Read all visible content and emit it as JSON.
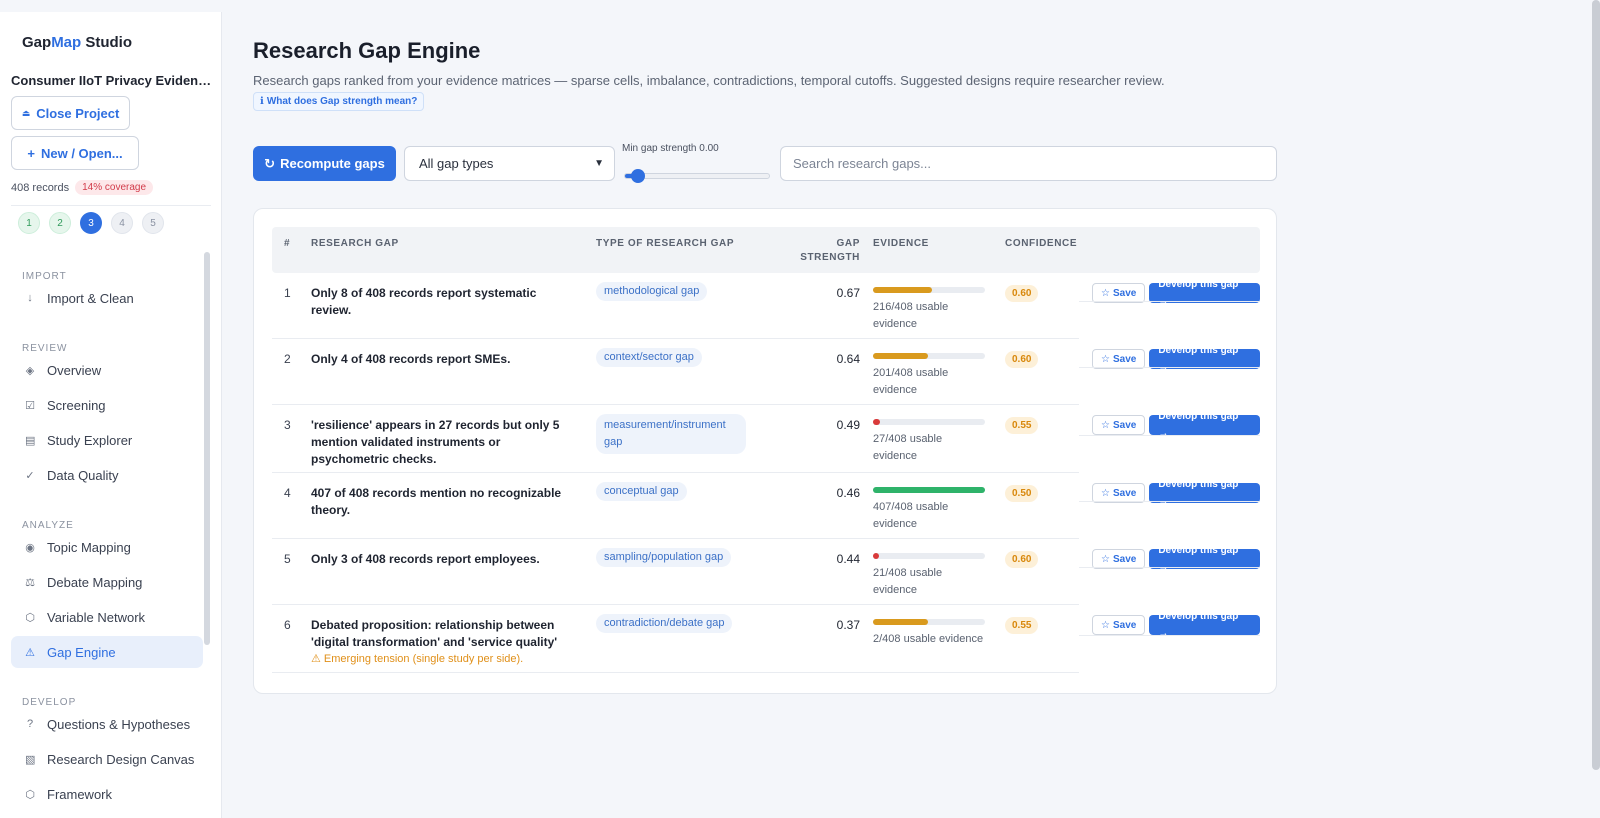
{
  "brand": {
    "part1": "Gap",
    "part2": "Map",
    "part3": " Studio"
  },
  "project": {
    "name": "Consumer IIoT Privacy Evidence ...",
    "close_label": "Close Project",
    "new_label": "New / Open...",
    "records": "408 records",
    "coverage": "14% coverage"
  },
  "steps": [
    "1",
    "2",
    "3",
    "4",
    "5"
  ],
  "nav": {
    "import_header": "IMPORT",
    "import_clean": "Import & Clean",
    "review_header": "REVIEW",
    "overview": "Overview",
    "screening": "Screening",
    "study_explorer": "Study Explorer",
    "data_quality": "Data Quality",
    "analyze_header": "ANALYZE",
    "topic_mapping": "Topic Mapping",
    "debate_mapping": "Debate Mapping",
    "variable_network": "Variable Network",
    "gap_engine": "Gap Engine",
    "develop_header": "DEVELOP",
    "questions": "Questions & Hypotheses",
    "design_canvas": "Research Design Canvas",
    "framework": "Framework"
  },
  "page": {
    "title": "Research Gap Engine",
    "subtitle": "Research gaps ranked from your evidence matrices — sparse cells, imbalance, contradictions, temporal cutoffs. Suggested designs require researcher review.",
    "help": "What does Gap strength mean?"
  },
  "controls": {
    "recompute": "Recompute gaps",
    "gap_type_selected": "All gap types",
    "min_strength_label": "Min gap strength 0.00",
    "min_strength_value": 0.0,
    "search_placeholder": "Search research gaps..."
  },
  "table": {
    "headers": {
      "num": "#",
      "gap": "RESEARCH GAP",
      "type": "TYPE OF RESEARCH GAP",
      "strength_1": "GAP",
      "strength_2": "STRENGTH",
      "evidence": "EVIDENCE",
      "confidence": "CONFIDENCE"
    },
    "save_label": "Save",
    "develop_label": "Develop this gap →",
    "rows": [
      {
        "num": "1",
        "gap": "Only 8 of 408 records report systematic review.",
        "warn": "",
        "type": "methodological gap",
        "strength": "0.67",
        "evidence": "216/408 usable evidence",
        "evidence_frac": 0.53,
        "evidence_color": "#d99a1e",
        "confidence": "0.60"
      },
      {
        "num": "2",
        "gap": "Only 4 of 408 records report SMEs.",
        "warn": "",
        "type": "context/sector gap",
        "strength": "0.64",
        "evidence": "201/408 usable evidence",
        "evidence_frac": 0.49,
        "evidence_color": "#d99a1e",
        "confidence": "0.60"
      },
      {
        "num": "3",
        "gap": "'resilience' appears in 27 records but only 5 mention validated instruments or psychometric checks.",
        "warn": "",
        "type": "measurement/instrument gap",
        "strength": "0.49",
        "evidence": "27/408 usable evidence",
        "evidence_frac": 0.066,
        "evidence_color": "#d93a3a",
        "confidence": "0.55"
      },
      {
        "num": "4",
        "gap": "407 of 408 records mention no recognizable theory.",
        "warn": "",
        "type": "conceptual gap",
        "strength": "0.46",
        "evidence": "407/408 usable evidence",
        "evidence_frac": 0.998,
        "evidence_color": "#2fb36a",
        "confidence": "0.50"
      },
      {
        "num": "5",
        "gap": "Only 3 of 408 records report employees.",
        "warn": "",
        "type": "sampling/population gap",
        "strength": "0.44",
        "evidence": "21/408 usable evidence",
        "evidence_frac": 0.051,
        "evidence_color": "#d93a3a",
        "confidence": "0.60"
      },
      {
        "num": "6",
        "gap": "Debated proposition: relationship between 'digital transformation' and 'service quality'",
        "warn": "⚠ Emerging tension (single study per side).",
        "type": "contradiction/debate gap",
        "strength": "0.37",
        "evidence": "2/408 usable evidence",
        "evidence_frac": 0.49,
        "evidence_color": "#d99a1e",
        "confidence": "0.55"
      }
    ]
  },
  "colors": {
    "accent": "#2f6fe0",
    "warning": "#e0901a",
    "danger": "#d93a3a",
    "success": "#2fb36a"
  }
}
